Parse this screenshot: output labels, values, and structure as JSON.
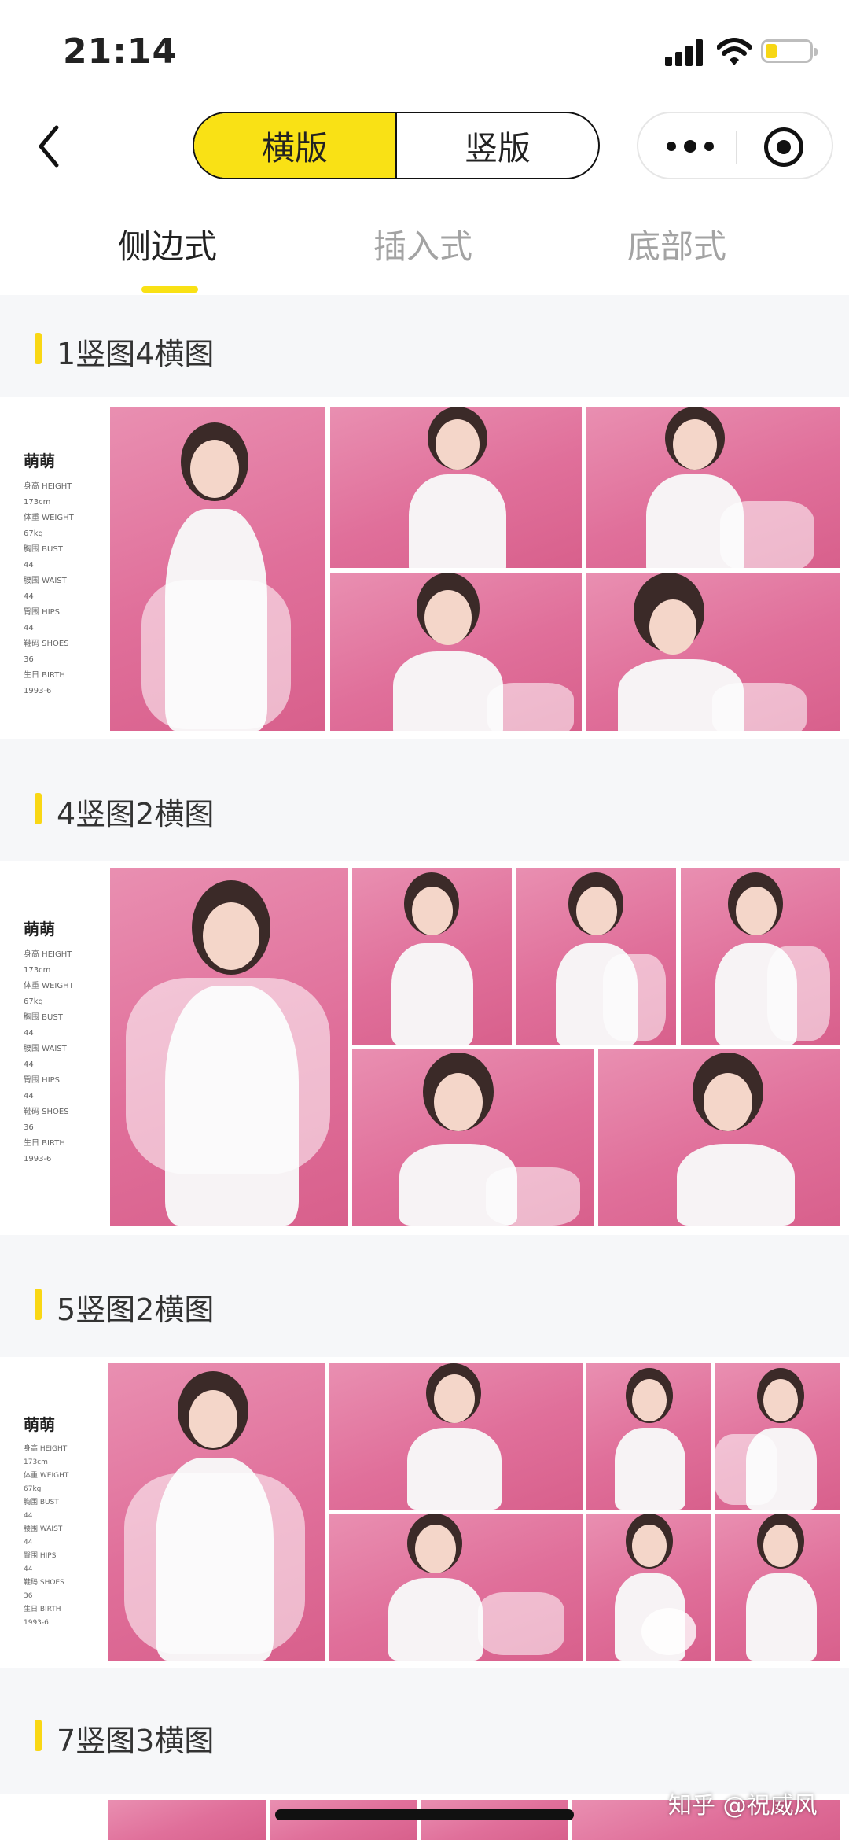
{
  "status_bar": {
    "time": "21:14"
  },
  "nav": {
    "segments": [
      "横版",
      "竖版"
    ],
    "active_segment": 0
  },
  "tabs": [
    "侧边式",
    "插入式",
    "底部式"
  ],
  "sections": [
    {
      "title": "1竖图4横图",
      "model": {
        "name": "萌萌",
        "stats": [
          "身高 HEIGHT",
          "173cm",
          "体重 WEIGHT",
          "67kg",
          "胸围 BUST",
          "44",
          "腰围 WAIST",
          "44",
          "臀围 HIPS",
          "44",
          "鞋码 SHOES",
          "36",
          "生日 BIRTH",
          "1993-6"
        ]
      }
    },
    {
      "title": "4竖图2横图",
      "model": {
        "name": "萌萌",
        "stats": [
          "身高 HEIGHT",
          "173cm",
          "体重 WEIGHT",
          "67kg",
          "胸围 BUST",
          "44",
          "腰围 WAIST",
          "44",
          "臀围 HIPS",
          "44",
          "鞋码 SHOES",
          "36",
          "生日 BIRTH",
          "1993-6"
        ]
      }
    },
    {
      "title": "5竖图2横图",
      "model": {
        "name": "萌萌",
        "stats": [
          "身高 HEIGHT",
          "173cm",
          "体重 WEIGHT",
          "67kg",
          "胸围 BUST",
          "44",
          "腰围 WAIST",
          "44",
          "臀围 HIPS",
          "44",
          "鞋码 SHOES",
          "36",
          "生日 BIRTH",
          "1993-6"
        ]
      }
    },
    {
      "title": "7竖图3横图"
    }
  ],
  "watermark": "知乎 @祝威风",
  "colors": {
    "accent": "#f9e115",
    "photo_bg": "#e47aa2",
    "page_bg": "#f6f7f9"
  }
}
